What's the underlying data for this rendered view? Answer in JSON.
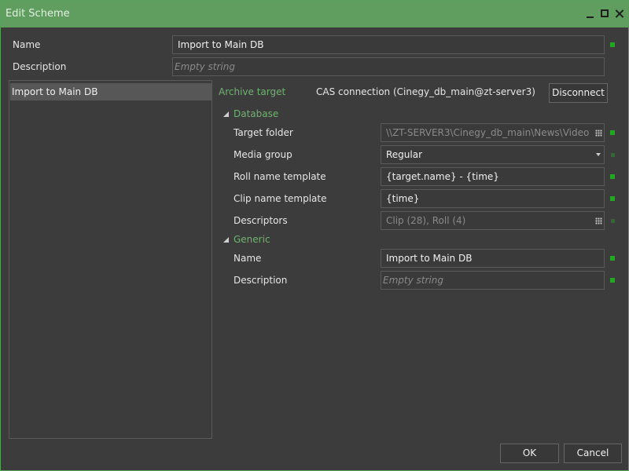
{
  "window": {
    "title": "Edit Scheme"
  },
  "top": {
    "name_label": "Name",
    "name_value": "Import to Main DB",
    "description_label": "Description",
    "description_placeholder": "Empty string"
  },
  "scheme_list": {
    "items": [
      "Import to Main DB"
    ]
  },
  "archive": {
    "label": "Archive target",
    "connection": "CAS connection (Cinegy_db_main@zt-server3)",
    "disconnect_label": "Disconnect"
  },
  "database": {
    "section_label": "Database",
    "target_folder_label": "Target folder",
    "target_folder_value": "\\\\ZT-SERVER3\\Cinegy_db_main\\News\\Video",
    "media_group_label": "Media group",
    "media_group_value": "Regular",
    "roll_template_label": "Roll name template",
    "roll_template_value": "{target.name} - {time}",
    "clip_template_label": "Clip name template",
    "clip_template_value": "{time}",
    "descriptors_label": "Descriptors",
    "descriptors_value": "Clip (28), Roll (4)"
  },
  "generic": {
    "section_label": "Generic",
    "name_label": "Name",
    "name_value": "Import to Main DB",
    "description_label": "Description",
    "description_placeholder": "Empty string"
  },
  "footer": {
    "ok_label": "OK",
    "cancel_label": "Cancel"
  },
  "colors": {
    "accent": "#5f9e5f",
    "marker": "#22a722",
    "background": "#3c3c3c"
  }
}
